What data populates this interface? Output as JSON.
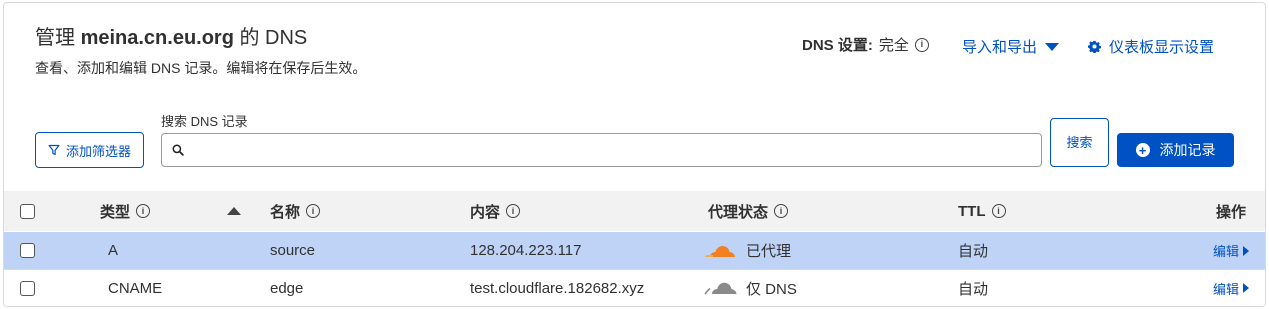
{
  "header": {
    "title_prefix": "管理 ",
    "domain": "meina.cn.eu.org",
    "title_suffix": " 的 DNS",
    "subtitle": "查看、添加和编辑 DNS 记录。编辑将在保存后生效。",
    "dns_setting_label": "DNS 设置:",
    "dns_setting_value": "完全",
    "import_export_label": "导入和导出",
    "dashboard_settings_label": "仪表板显示设置"
  },
  "toolbar": {
    "filter_label": "添加筛选器",
    "search_label": "搜索 DNS 记录",
    "search_value": "",
    "search_button_label": "搜索",
    "add_record_label": "添加记录"
  },
  "table": {
    "columns": {
      "type": "类型",
      "name": "名称",
      "content": "内容",
      "proxy": "代理状态",
      "ttl": "TTL",
      "actions": "操作"
    },
    "rows": [
      {
        "type": "A",
        "name": "source",
        "content": "128.204.223.117",
        "proxy": "已代理",
        "proxy_icon": "cloud-orange-icon",
        "ttl": "自动",
        "edit": "编辑",
        "selected": true
      },
      {
        "type": "CNAME",
        "name": "edge",
        "content": "test.cloudflare.182682.xyz",
        "proxy": "仅 DNS",
        "proxy_icon": "cloud-grey-icon",
        "ttl": "自动",
        "edit": "编辑",
        "selected": false
      }
    ]
  },
  "colors": {
    "accent": "#0051c3",
    "selected_row": "#bfd3f7",
    "proxied_cloud": "#f38020",
    "dns_only_cloud": "#8a8a8a"
  }
}
